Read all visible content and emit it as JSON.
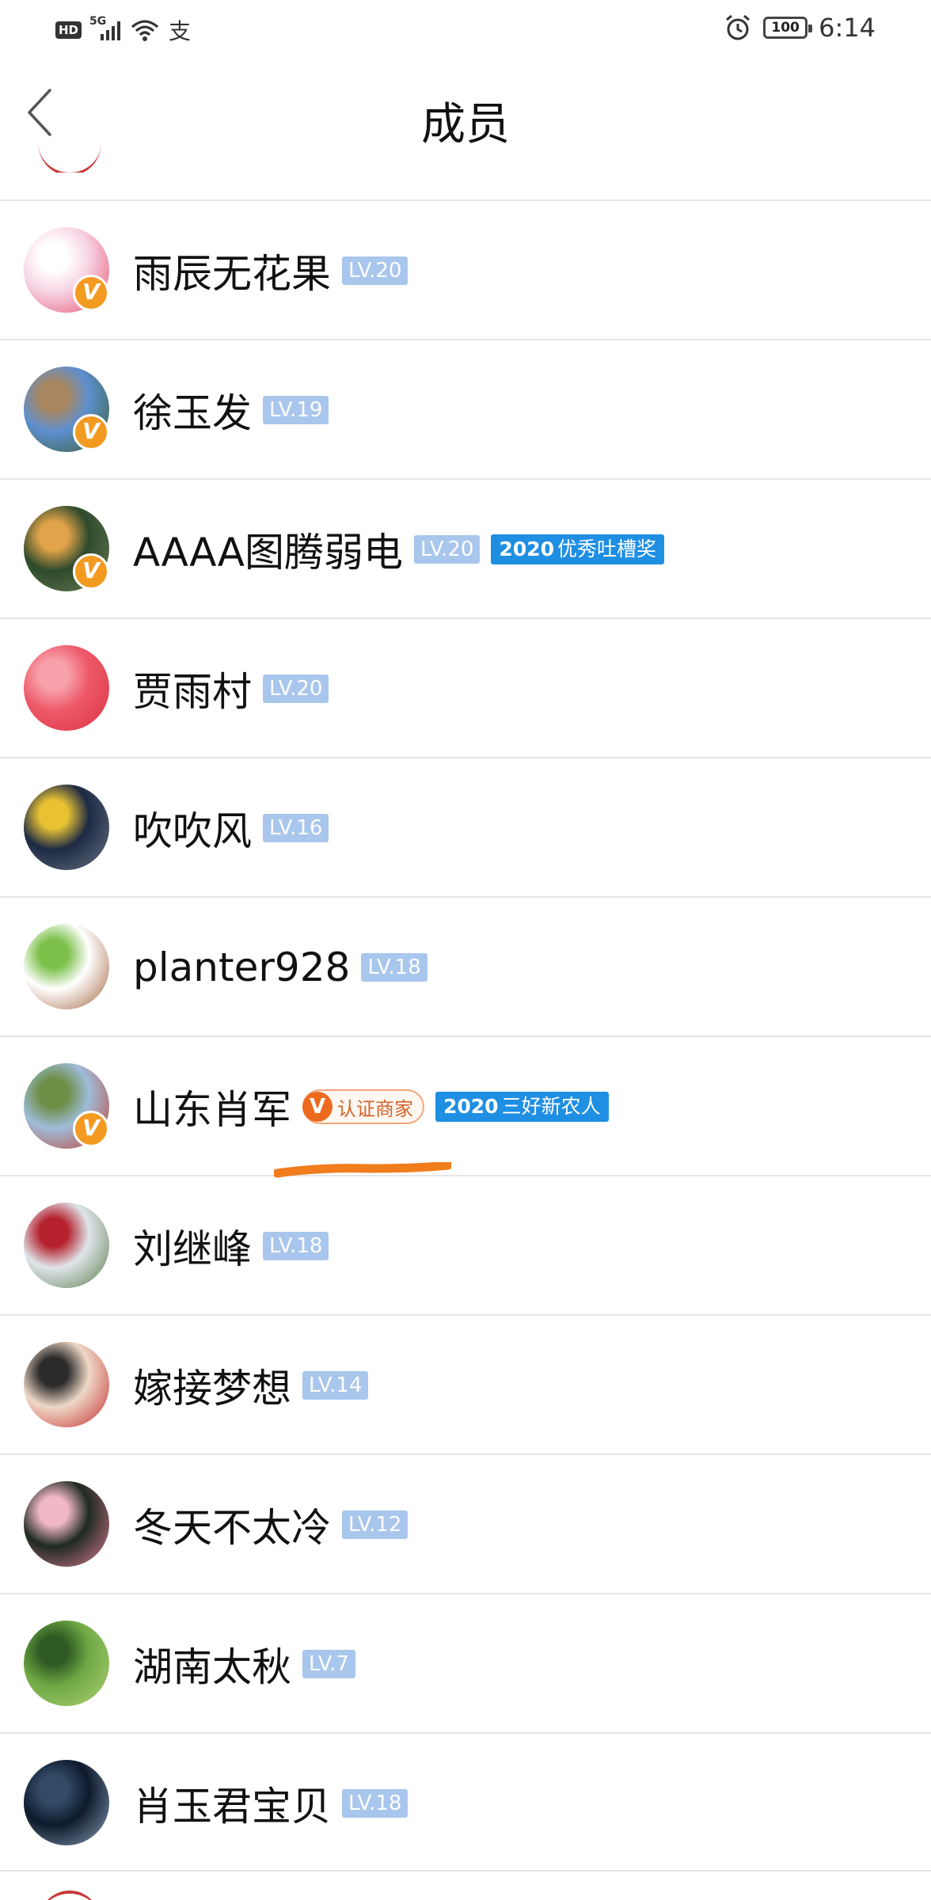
{
  "status_bar": {
    "hd": "HD",
    "network": "5G",
    "alipay_glyph": "支",
    "battery": "100",
    "time": "6:14"
  },
  "header": {
    "title": "成员",
    "back_icon": "chevron-left-icon"
  },
  "members": [
    {
      "name": "雨辰无花果",
      "level": "LV.20",
      "verified": true,
      "avatar_colors": [
        "#f7d4e4",
        "#ffffff",
        "#e64b6a"
      ]
    },
    {
      "name": "徐玉发",
      "level": "LV.19",
      "verified": true,
      "avatar_colors": [
        "#5d8fd0",
        "#a88760",
        "#3a5d2a"
      ]
    },
    {
      "name": "AAAA图腾弱电",
      "level": "LV.20",
      "verified": true,
      "award": {
        "year": "2020",
        "text": "优秀吐槽奖"
      },
      "avatar_colors": [
        "#2e4a2c",
        "#e2a34a",
        "#6a7f55"
      ]
    },
    {
      "name": "贾雨村",
      "level": "LV.20",
      "verified": false,
      "avatar_colors": [
        "#ee5a6a",
        "#f7a2ab",
        "#d9323f"
      ]
    },
    {
      "name": "吹吹风",
      "level": "LV.16",
      "verified": false,
      "avatar_colors": [
        "#1d2a44",
        "#e8c233",
        "#6b7584"
      ]
    },
    {
      "name": "planter928",
      "level": "LV.18",
      "verified": false,
      "avatar_colors": [
        "#ffffff",
        "#7cc04a",
        "#a0603a"
      ]
    },
    {
      "name": "山东肖军",
      "level": "",
      "verified": true,
      "merchant": {
        "icon": "V",
        "text": "认证商家"
      },
      "award": {
        "year": "2020",
        "text": "三好新农人"
      },
      "avatar_colors": [
        "#9fbcd9",
        "#6c8f46",
        "#c53a2a"
      ]
    },
    {
      "name": "刘继峰",
      "level": "LV.18",
      "verified": false,
      "avatar_colors": [
        "#dfe5ea",
        "#b5222e",
        "#5a7a48"
      ]
    },
    {
      "name": "嫁接梦想",
      "level": "LV.14",
      "verified": false,
      "avatar_colors": [
        "#efd8c6",
        "#2b2b2b",
        "#c0282a"
      ]
    },
    {
      "name": "冬天不太冷",
      "level": "LV.12",
      "verified": false,
      "avatar_colors": [
        "#1e2a20",
        "#f2b8c8",
        "#e07d98"
      ]
    },
    {
      "name": "湖南太秋",
      "level": "LV.7",
      "verified": false,
      "avatar_colors": [
        "#6ea844",
        "#2f5a23",
        "#b2d276"
      ]
    },
    {
      "name": "肖玉君宝贝",
      "level": "LV.18",
      "verified": false,
      "avatar_colors": [
        "#0e1a2c",
        "#324a66",
        "#8aa1b8"
      ]
    }
  ],
  "colors": {
    "level_badge": "#a9c6ec",
    "award_badge": "#1f8fe3",
    "verified_badge": "#f39a21",
    "merchant_badge": "#ec6a1f",
    "annotation_stroke": "#f07c1c"
  }
}
